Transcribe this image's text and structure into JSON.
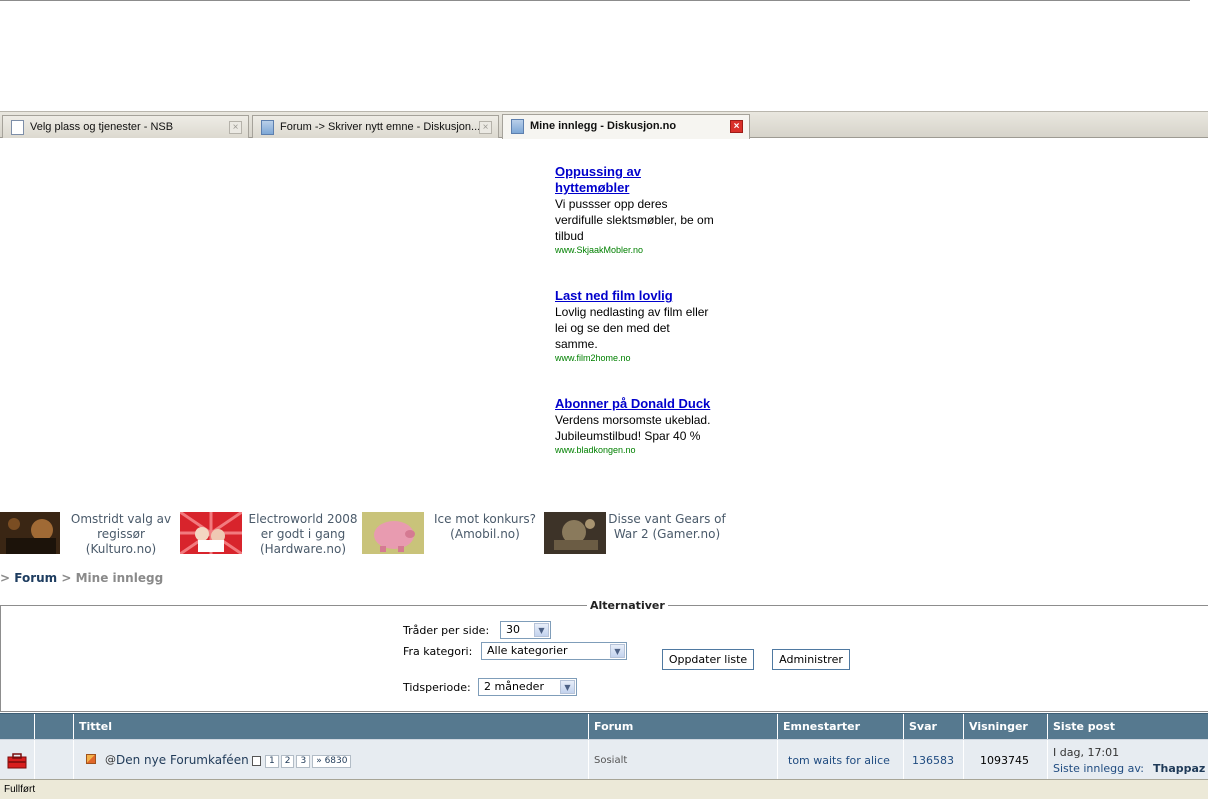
{
  "tabs": [
    {
      "title": "Velg plass og tjenester - NSB"
    },
    {
      "title": "Forum -> Skriver nytt emne - Diskusjon..."
    },
    {
      "title": "Mine innlegg - Diskusjon.no"
    }
  ],
  "ads": [
    {
      "title": "Oppussing av hyttemøbler",
      "text": "Vi pussser opp deres verdifulle slektsmøbler, be om tilbud",
      "url": "www.SkjaakMobler.no"
    },
    {
      "title": "Last ned film lovlig",
      "text": "Lovlig nedlasting av film eller lei og se den med det samme.",
      "url": "www.film2home.no"
    },
    {
      "title": "Abonner på Donald Duck",
      "text": "Verdens morsomste ukeblad. Jubileumstilbud! Spar 40 %",
      "url": "www.bladkongen.no"
    }
  ],
  "news": [
    {
      "caption": "Omstridt valg av regissør (Kulturo.no)"
    },
    {
      "caption": "Electroworld 2008 er godt i gang (Hardware.no)"
    },
    {
      "caption": "Ice mot konkurs? (Amobil.no)"
    },
    {
      "caption": "Disse vant Gears of War 2 (Gamer.no)"
    }
  ],
  "breadcrumb": {
    "prefix": ">",
    "home": "Forum",
    "sep": ">",
    "current": "Mine innlegg"
  },
  "alternatives": {
    "legend": "Alternativer",
    "threads_label": "Tråder per side:",
    "threads_value": "30",
    "category_label": "Fra kategori:",
    "category_value": "Alle kategorier",
    "period_label": "Tidsperiode:",
    "period_value": "2 måneder",
    "update_button": "Oppdater liste",
    "admin_button": "Administrer"
  },
  "table": {
    "headers": {
      "title": "Tittel",
      "forum": "Forum",
      "starter": "Emnestarter",
      "replies": "Svar",
      "views": "Visninger",
      "last": "Siste post"
    },
    "rows": [
      {
        "title": "Den nye Forumkaféen",
        "pages": [
          "1",
          "2",
          "3",
          "» 6830"
        ],
        "forum": "Sosialt",
        "starter": "tom waits for alice",
        "replies": "136583",
        "views": "1093745",
        "last_time": "I dag, 17:01",
        "last_prefix": "Siste innlegg av:",
        "last_user": "Thappaz"
      }
    ]
  },
  "status": "Fullført"
}
